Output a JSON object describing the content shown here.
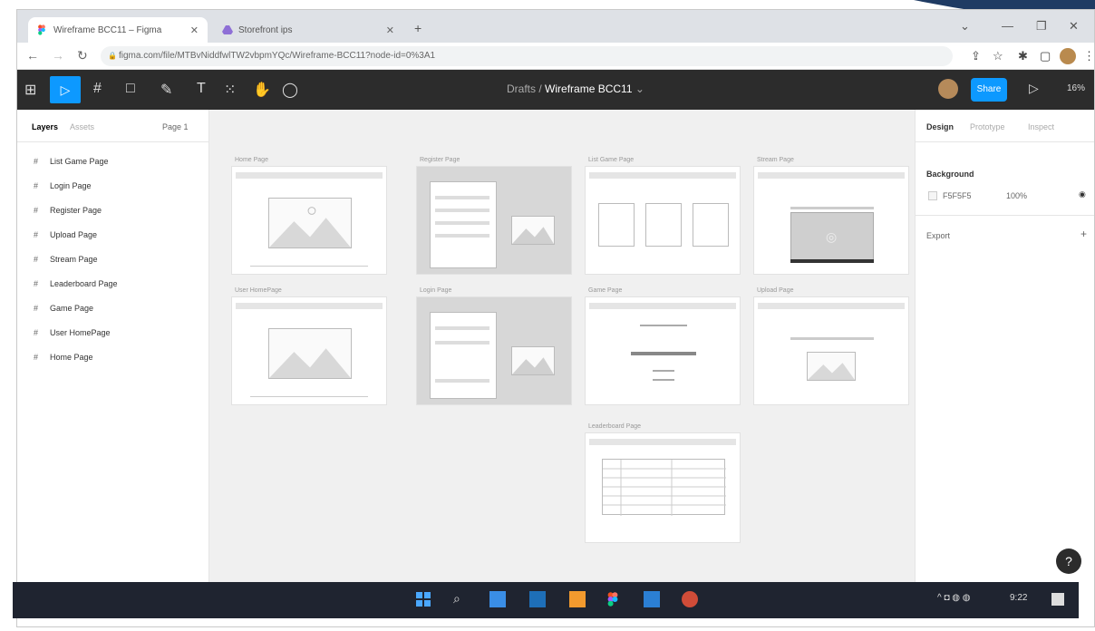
{
  "browser": {
    "tabs": [
      {
        "title": "Wireframe BCC11 – Figma"
      },
      {
        "title": "Storefront ips"
      }
    ],
    "new_tab": "+",
    "url": "figma.com/file/MTBvNiddfwlTW2vbpmYQc/Wireframe-BCC11?node-id=0%3A1",
    "window_controls": [
      "⌄",
      "—",
      "❐",
      "✕"
    ]
  },
  "figma": {
    "tools": [
      "move-tool",
      "frame-tool",
      "shape-tool",
      "pen-tool",
      "text-tool",
      "resources-tool",
      "hand-tool",
      "comment-tool"
    ],
    "breadcrumb_folder": "Drafts",
    "breadcrumb_sep": "/",
    "file_name": "Wireframe BCC11",
    "share_label": "Share",
    "zoom": "16%"
  },
  "layers_panel": {
    "tab_layers": "Layers",
    "tab_assets": "Assets",
    "page_selector": "Page 1",
    "layers": [
      "List Game Page",
      "Login Page",
      "Register Page",
      "Upload Page",
      "Stream Page",
      "Leaderboard Page",
      "Game Page",
      "User HomePage",
      "Home Page"
    ]
  },
  "canvas": {
    "frames": [
      {
        "label": "Home Page"
      },
      {
        "label": "Register Page"
      },
      {
        "label": "List Game Page"
      },
      {
        "label": "Stream Page"
      },
      {
        "label": "User HomePage"
      },
      {
        "label": "Login Page"
      },
      {
        "label": "Game Page"
      },
      {
        "label": "Upload Page"
      },
      {
        "label": "Leaderboard Page"
      }
    ]
  },
  "design_panel": {
    "tab_design": "Design",
    "tab_prototype": "Prototype",
    "tab_inspect": "Inspect",
    "background_label": "Background",
    "bg_hex": "F5F5F5",
    "bg_opacity": "100%",
    "export_label": "Export",
    "bg_color": "#f5f5f5"
  },
  "help_label": "?",
  "taskbar": {
    "time": "9:22"
  }
}
